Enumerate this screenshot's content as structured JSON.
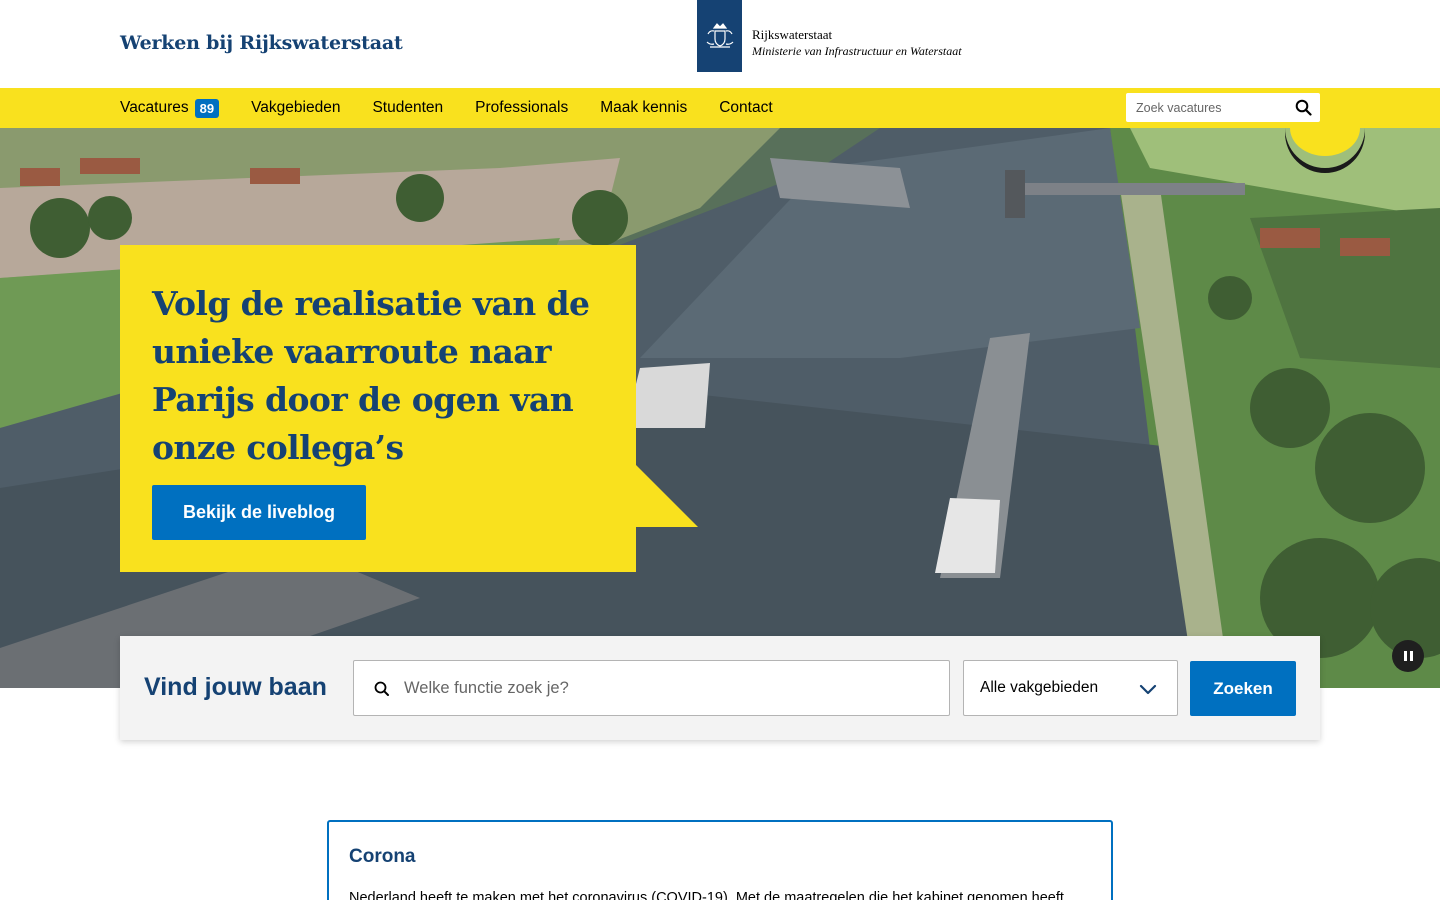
{
  "header": {
    "site_title": "Werken bij Rijkswaterstaat",
    "logo_name": "Rijkswaterstaat",
    "logo_subtitle": "Ministerie van Infrastructuur en Waterstaat",
    "logo_icon": "rijkswapen-crest-icon"
  },
  "nav": {
    "items": [
      {
        "label": "Vacatures",
        "badge": "89"
      },
      {
        "label": "Vakgebieden"
      },
      {
        "label": "Studenten"
      },
      {
        "label": "Professionals"
      },
      {
        "label": "Maak kennis"
      },
      {
        "label": "Contact"
      }
    ],
    "search_placeholder": "Zoek vacatures",
    "search_icon": "search-icon"
  },
  "hero": {
    "title": "Volg de realisatie van de unieke vaarroute naar Parijs door de ogen van onze collega’s",
    "button_label": "Bekijk de liveblog",
    "pause_icon": "pause-icon"
  },
  "job_search": {
    "heading": "Vind jouw baan",
    "input_placeholder": "Welke functie zoek je?",
    "select_value": "Alle vakgebieden",
    "submit_label": "Zoeken"
  },
  "notice": {
    "title": "Corona",
    "text": "Nederland heeft te maken met het coronavirus (COVID-19). Met de maatregelen die het kabinet genomen heeft"
  },
  "colors": {
    "brand_blue": "#154273",
    "accent_yellow": "#f9e11e",
    "button_blue": "#0070c0"
  }
}
